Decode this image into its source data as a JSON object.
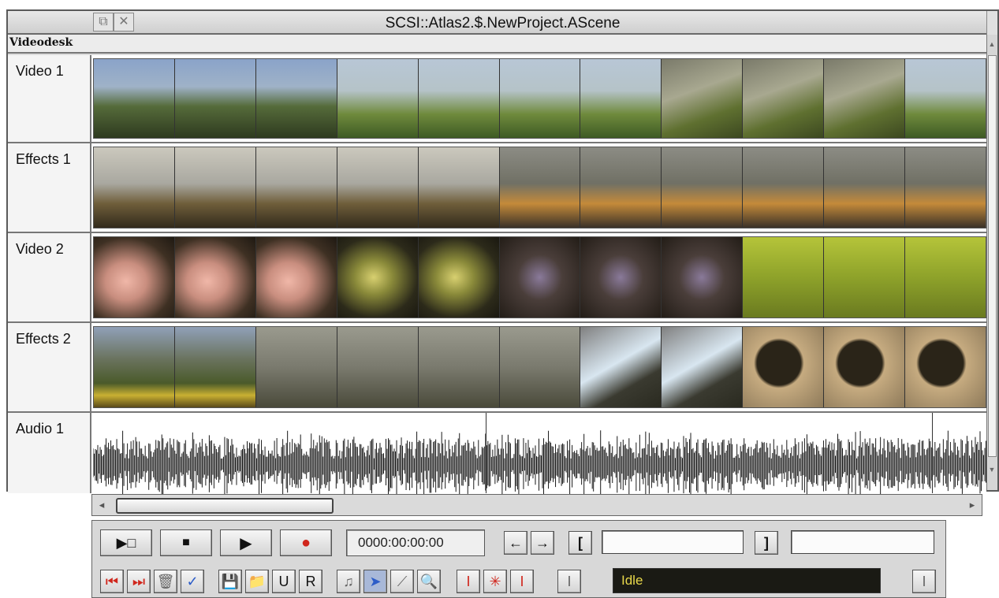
{
  "window": {
    "title": "SCSI::Atlas2.$.NewProject.AScene",
    "menu_label": "Videodesk"
  },
  "tracks": [
    {
      "label": "Video 1"
    },
    {
      "label": "Effects 1"
    },
    {
      "label": "Video 2"
    },
    {
      "label": "Effects 2"
    },
    {
      "label": "Audio 1"
    }
  ],
  "transport": {
    "timecode": "0000:00:00:00",
    "prev_mark": "←",
    "next_mark": "→"
  },
  "tools": {
    "undo_label": "U",
    "redo_label": "R",
    "tick": "✓"
  },
  "status": {
    "text": "Idle"
  },
  "icons": {
    "record_color": "#d0261c",
    "status_text_color": "#e8d84a"
  }
}
